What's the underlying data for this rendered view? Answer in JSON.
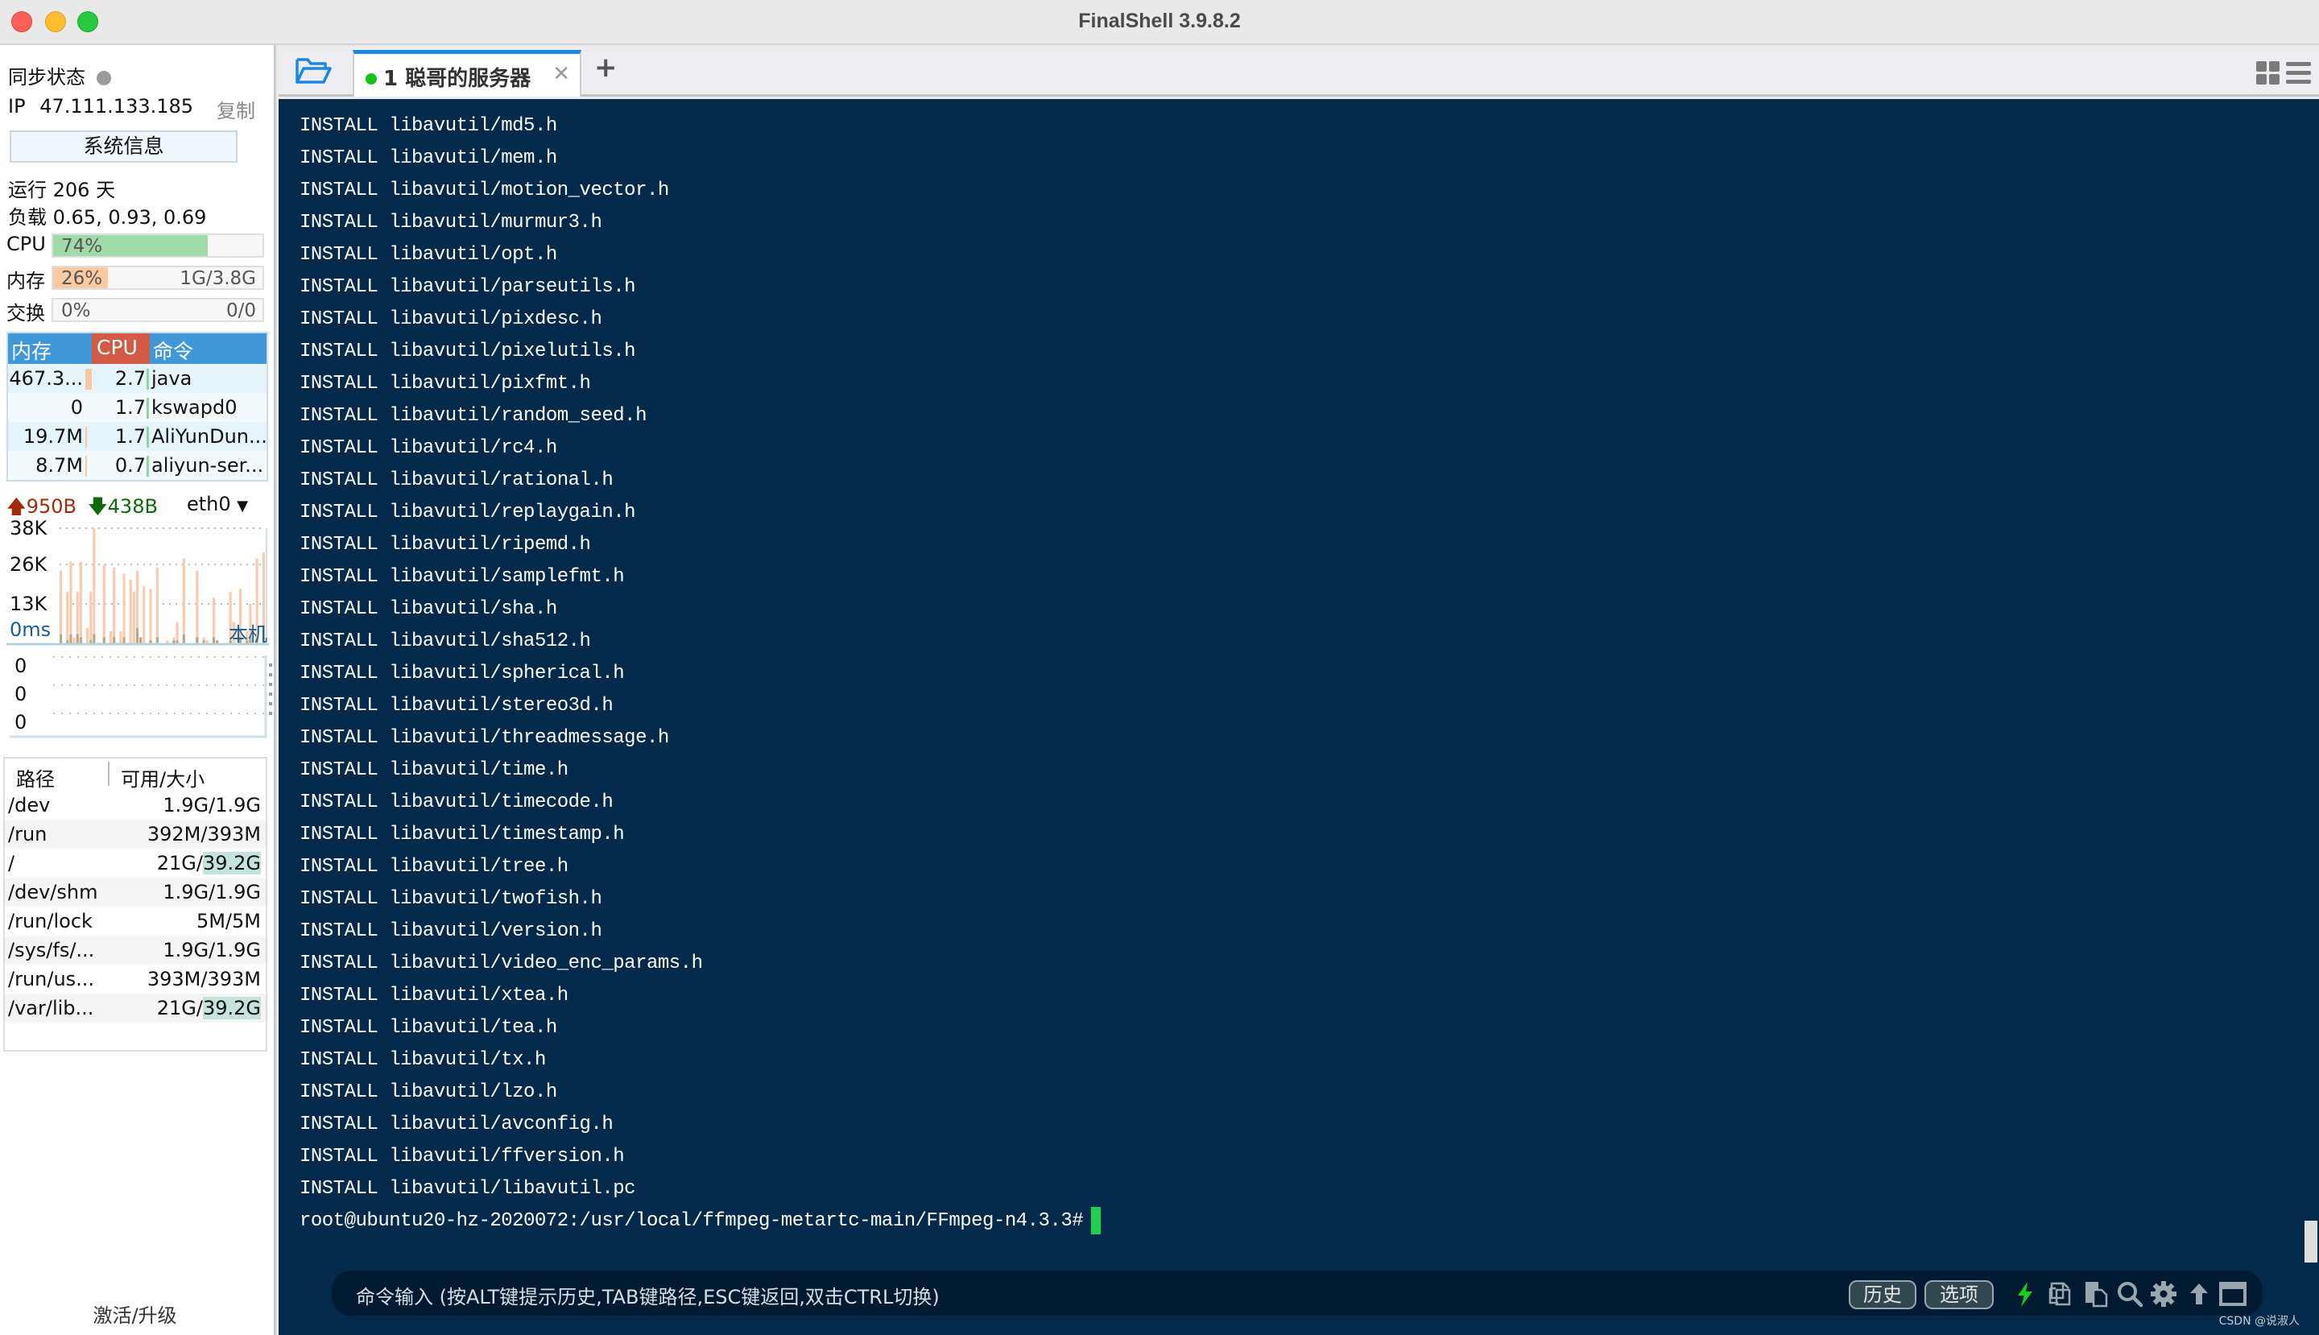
{
  "window": {
    "title": "FinalShell 3.9.8.2"
  },
  "sidebar": {
    "sync_label": "同步状态",
    "ip_label": "IP",
    "ip_value": "47.111.133.185",
    "copy_label": "复制",
    "sysinfo_button": "系统信息",
    "uptime": "运行 206 天",
    "load": "负载 0.65, 0.93, 0.69",
    "meters": {
      "cpu": {
        "label": "CPU",
        "percent_text": "74%",
        "percent": 74,
        "amount": ""
      },
      "memory": {
        "label": "内存",
        "percent_text": "26%",
        "percent": 26,
        "amount": "1G/3.8G"
      },
      "swap": {
        "label": "交换",
        "percent_text": "0%",
        "percent": 0,
        "amount": "0/0"
      }
    },
    "process_table": {
      "headers": {
        "memory": "内存",
        "cpu": "CPU",
        "command": "命令"
      },
      "rows": [
        {
          "memory": "467.3...",
          "cpu": "2.7",
          "command": "java"
        },
        {
          "memory": "0",
          "cpu": "1.7",
          "command": "kswapd0"
        },
        {
          "memory": "19.7M",
          "cpu": "1.7",
          "command": "AliYunDun..."
        },
        {
          "memory": "8.7M",
          "cpu": "0.7",
          "command": "aliyun-ser..."
        }
      ]
    },
    "network": {
      "upload": "950B",
      "download": "438B",
      "interface": "eth0",
      "y_ticks": [
        "38K",
        "26K",
        "13K"
      ],
      "upload_series_k": [
        24,
        0,
        17,
        27,
        2,
        17,
        27,
        0,
        5,
        17,
        38,
        0,
        0,
        26,
        0,
        4,
        25,
        0,
        4,
        23,
        0,
        21,
        17,
        24,
        0,
        19,
        0,
        18,
        0,
        25,
        0,
        0,
        1,
        0,
        2,
        7,
        0,
        28,
        0,
        0,
        0,
        24,
        0,
        2,
        1,
        0,
        15,
        1,
        0,
        0,
        0,
        17,
        7,
        0,
        18,
        0,
        4,
        13,
        0,
        28,
        0,
        30
      ],
      "download_series_k": [
        3,
        0,
        1,
        3,
        0,
        3,
        2,
        0,
        0,
        1,
        3,
        0,
        0,
        2,
        0,
        0,
        2,
        0,
        0,
        2,
        0,
        0,
        0,
        5,
        2,
        0,
        0,
        1,
        0,
        2,
        0,
        0,
        0,
        0,
        1,
        1,
        0,
        3,
        0,
        0,
        0,
        2,
        0,
        1,
        0,
        0,
        2,
        1,
        0,
        0,
        0,
        1,
        0,
        0,
        2,
        0,
        1,
        2,
        0,
        2,
        0,
        6
      ]
    },
    "ping": {
      "latency": "0ms",
      "host": "本机",
      "y_ticks": [
        "0",
        "0",
        "0"
      ]
    },
    "disk_table": {
      "headers": {
        "path": "路径",
        "size": "可用/大小"
      },
      "rows": [
        {
          "path": "/dev",
          "avail": "1.9G",
          "size": "1.9G",
          "highlight": false
        },
        {
          "path": "/run",
          "avail": "392M",
          "size": "393M",
          "highlight": false
        },
        {
          "path": "/",
          "avail": "21G",
          "size": "39.2G",
          "highlight": true
        },
        {
          "path": "/dev/shm",
          "avail": "1.9G",
          "size": "1.9G",
          "highlight": false
        },
        {
          "path": "/run/lock",
          "avail": "5M",
          "size": "5M",
          "highlight": false
        },
        {
          "path": "/sys/fs/...",
          "avail": "1.9G",
          "size": "1.9G",
          "highlight": false
        },
        {
          "path": "/run/us...",
          "avail": "393M",
          "size": "393M",
          "highlight": false
        },
        {
          "path": "/var/lib...",
          "avail": "21G",
          "size": "39.2G",
          "highlight": true
        }
      ]
    },
    "activate_label": "激活/升级"
  },
  "tabs": [
    {
      "label": "1 聪哥的服务器",
      "connected": true,
      "active": true
    }
  ],
  "terminal": {
    "lines": [
      "INSTALL libavutil/md5.h",
      "INSTALL libavutil/mem.h",
      "INSTALL libavutil/motion_vector.h",
      "INSTALL libavutil/murmur3.h",
      "INSTALL libavutil/opt.h",
      "INSTALL libavutil/parseutils.h",
      "INSTALL libavutil/pixdesc.h",
      "INSTALL libavutil/pixelutils.h",
      "INSTALL libavutil/pixfmt.h",
      "INSTALL libavutil/random_seed.h",
      "INSTALL libavutil/rc4.h",
      "INSTALL libavutil/rational.h",
      "INSTALL libavutil/replaygain.h",
      "INSTALL libavutil/ripemd.h",
      "INSTALL libavutil/samplefmt.h",
      "INSTALL libavutil/sha.h",
      "INSTALL libavutil/sha512.h",
      "INSTALL libavutil/spherical.h",
      "INSTALL libavutil/stereo3d.h",
      "INSTALL libavutil/threadmessage.h",
      "INSTALL libavutil/time.h",
      "INSTALL libavutil/timecode.h",
      "INSTALL libavutil/timestamp.h",
      "INSTALL libavutil/tree.h",
      "INSTALL libavutil/twofish.h",
      "INSTALL libavutil/version.h",
      "INSTALL libavutil/video_enc_params.h",
      "INSTALL libavutil/xtea.h",
      "INSTALL libavutil/tea.h",
      "INSTALL libavutil/tx.h",
      "INSTALL libavutil/lzo.h",
      "INSTALL libavutil/avconfig.h",
      "INSTALL libavutil/ffversion.h",
      "INSTALL libavutil/libavutil.pc"
    ],
    "prompt": "root@ubuntu20-hz-2020072:/usr/local/ffmpeg-metartc-main/FFmpeg-n4.3.3#"
  },
  "command_bar": {
    "placeholder": "命令输入 (按ALT键提示历史,TAB键路径,ESC键返回,双击CTRL切换)",
    "history_button": "历史",
    "options_button": "选项",
    "icons": [
      "lightning-icon",
      "copy-icon",
      "paste-icon",
      "search-icon",
      "gear-icon",
      "upload-arrow-icon",
      "window-icon"
    ]
  },
  "watermark": "CSDN @说淑人",
  "colors": {
    "terminal_bg": "#03294b",
    "cursor": "#1ed14b",
    "tab_accent": "#1a86e6",
    "cpu_fill": "#9edba8",
    "mem_fill": "#fbcaa3",
    "upload_bar": "#fcc8ae",
    "download_bar": "#b7a883"
  }
}
